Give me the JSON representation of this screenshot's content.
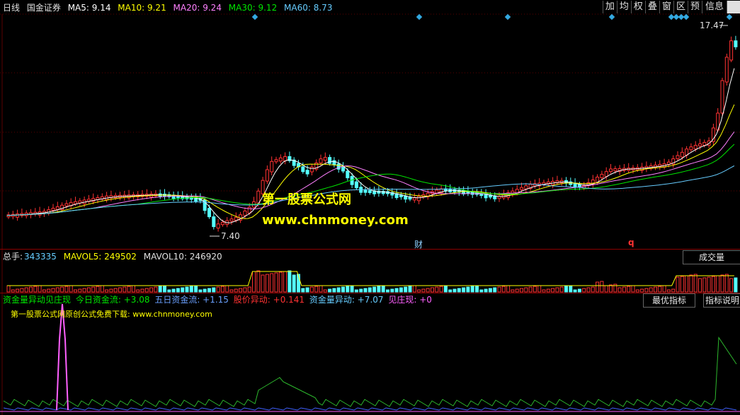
{
  "price_header": {
    "period": "日线",
    "stock": "国金证券",
    "ma5": "MA5: 9.14",
    "ma10": "MA10: 9.21",
    "ma20": "MA20: 9.24",
    "ma30": "MA30: 9.12",
    "ma60": "MA60: 8.73"
  },
  "toolbar": [
    "加",
    "均",
    "权",
    "叠",
    "窗",
    "区",
    "预",
    "信息"
  ],
  "price_marks": {
    "high": "17.47",
    "low": "7.40",
    "event_cai": "财",
    "event_q": "q"
  },
  "watermark": {
    "site": "第一股票公式网",
    "url": "www.chnmoney.com"
  },
  "volume_header": {
    "label": "总手:",
    "value": "343335",
    "mavol5": "MAVOL5: 249502",
    "mavol10": "MAVOL10: 246920"
  },
  "volume_button": "成交量",
  "indicator_header": {
    "name": "资金量异动见庄现",
    "jinri": "今日资金流: +3.08",
    "wuri": "五日资金流: +1.15",
    "gujia": "股价异动: +0.141",
    "zijin": "资金量异动: +7.07",
    "jianzhuang": "见庄现: +0"
  },
  "indicator_buttons": {
    "best": "最优指标",
    "help": "指标说明"
  },
  "indicator_note": "第一股票公式网原创公式免费下载: www.chnmoney.com",
  "colors": {
    "up": "#ff3232",
    "down": "#54ffff",
    "ma5": "#ffffff",
    "ma10": "#ffff00",
    "ma20": "#ff80ff",
    "ma30": "#00e600",
    "ma60": "#66ccff"
  }
}
